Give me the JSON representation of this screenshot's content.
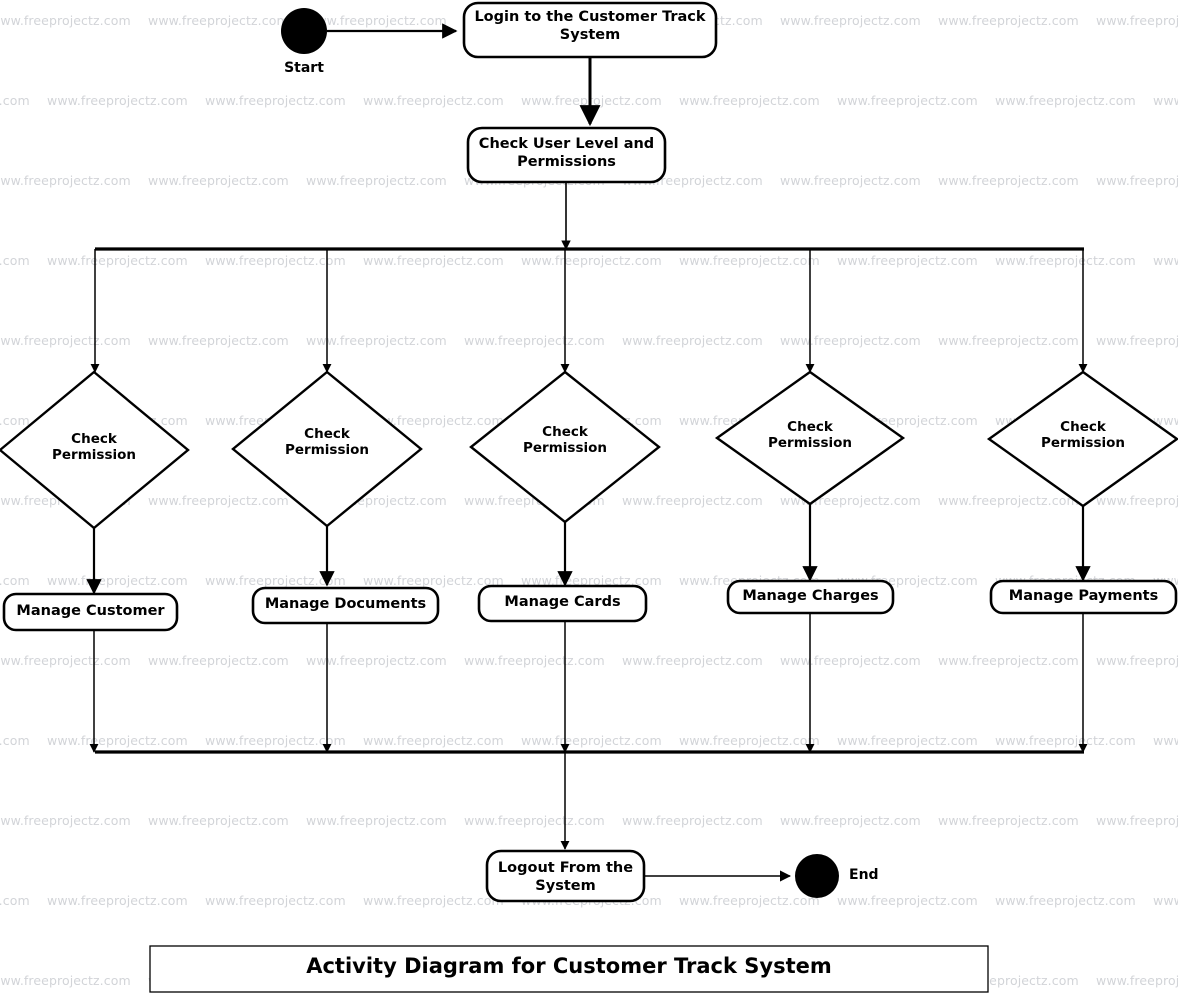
{
  "diagram": {
    "title": "Activity Diagram for Customer Track System",
    "type": "uml-activity-diagram",
    "watermark_text": "www.freeprojectz.com",
    "colors": {
      "stroke": "#000000",
      "fill": "#ffffff",
      "marker_fill": "#000000",
      "watermark": "#d2d4d8",
      "background": "#ffffff"
    },
    "start_label": "Start",
    "end_label": "End",
    "nodes": {
      "start": "Start",
      "login": "Login to the Customer Track\nSystem",
      "check_user": "Check User Level and\nPermissions",
      "logout": "Logout From the\nSystem",
      "end": "End"
    },
    "branches": [
      {
        "decision": "Check\nPermission",
        "action": "Manage Customer"
      },
      {
        "decision": "Check\nPermission",
        "action": "Manage Documents"
      },
      {
        "decision": "Check\nPermission",
        "action": "Manage Cards"
      },
      {
        "decision": "Check\nPermission",
        "action": "Manage Charges"
      },
      {
        "decision": "Check\nPermission",
        "action": "Manage Payments"
      }
    ]
  }
}
